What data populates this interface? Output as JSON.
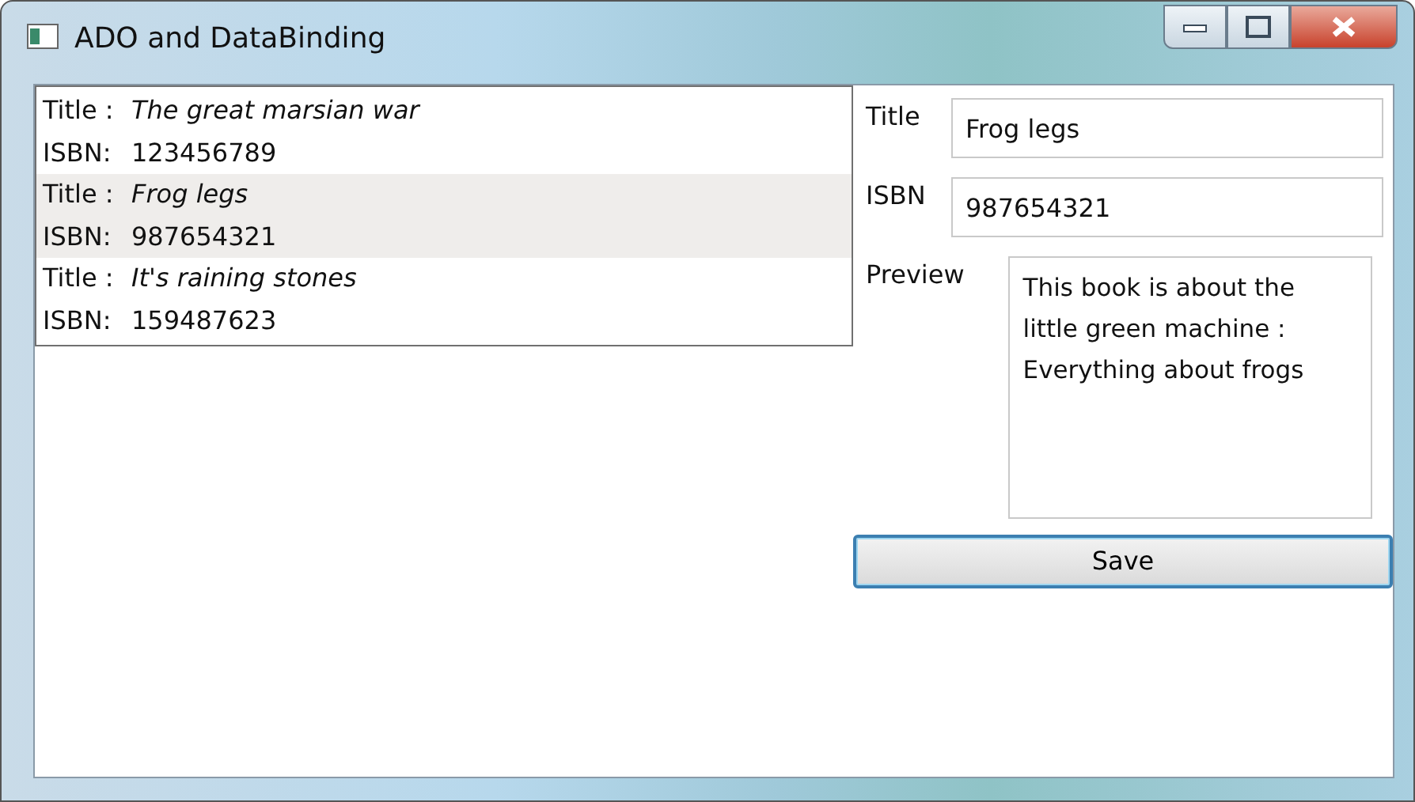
{
  "window": {
    "title": "ADO and DataBinding"
  },
  "books": [
    {
      "title_label": "Title :",
      "title": "The great marsian war",
      "isbn_label": "ISBN:",
      "isbn": "123456789",
      "selected": false
    },
    {
      "title_label": "Title :",
      "title": "Frog legs",
      "isbn_label": "ISBN:",
      "isbn": "987654321",
      "selected": true
    },
    {
      "title_label": "Title :",
      "title": "It's raining stones",
      "isbn_label": "ISBN:",
      "isbn": "159487623",
      "selected": false
    }
  ],
  "details": {
    "title_label": "Title",
    "title_value": "Frog legs",
    "isbn_label": "ISBN",
    "isbn_value": "987654321",
    "preview_label": "Preview",
    "preview_value": "This book is about the little green machine : Everything about frogs"
  },
  "buttons": [
    {
      "label": "Save",
      "focused": true
    }
  ]
}
